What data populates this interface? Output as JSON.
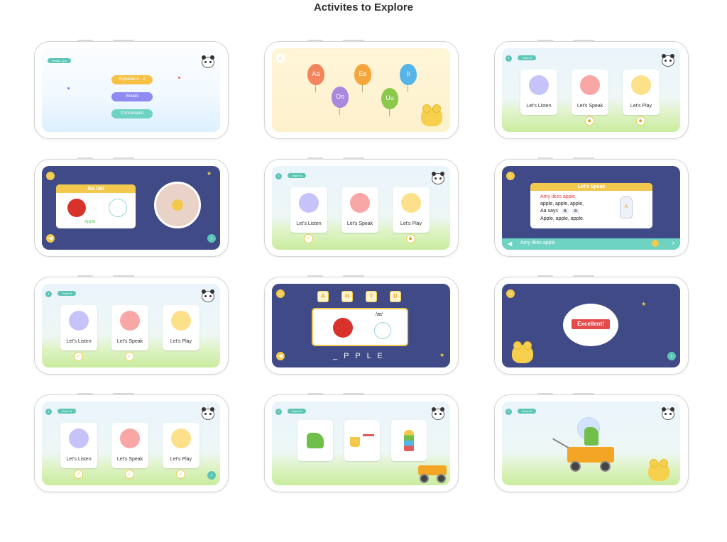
{
  "page": {
    "title": "Activites to Explore"
  },
  "screen1": {
    "badge": "Grade—gro",
    "buttons": [
      "Alphabet A - Z",
      "Vowels",
      "Consonants"
    ]
  },
  "screen2": {
    "balloons": [
      "Aa",
      "Ee",
      "Ii",
      "Oo",
      "Uu"
    ]
  },
  "vowel_badge": "Vowel A",
  "activity_cards": [
    "Let's Listen",
    "Let's Speak",
    "Let's Play"
  ],
  "screen4": {
    "phonics": "Aa /æ/",
    "word": "Apple"
  },
  "screen6": {
    "card_title": "Let's Speak",
    "lines": [
      "Amy likes apple,",
      "apple, apple, apple,",
      "Aa says",
      "Apple, apple, apple."
    ],
    "says_tiles": [
      "a",
      "a"
    ],
    "bar_text": "Amy likes apple",
    "rocket_letter": "A"
  },
  "screen8": {
    "tiles": [
      "A",
      "H",
      "T",
      "D"
    ],
    "phonics": "/æ/",
    "word": "_ P P L E"
  },
  "screen9": {
    "message": "Excellent!"
  },
  "icons": {
    "check": "✓",
    "lock": "🔒",
    "arrow": "›",
    "back": "‹",
    "home": "⌂",
    "sound": "◀"
  }
}
